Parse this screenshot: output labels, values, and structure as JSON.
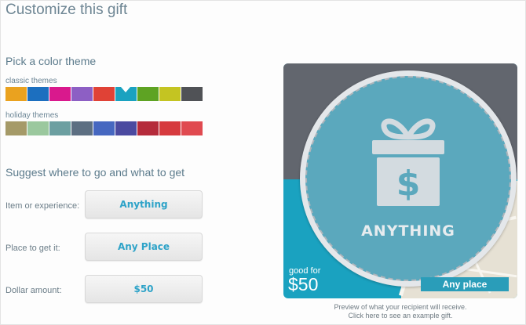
{
  "page": {
    "title": "Customize this gift"
  },
  "color_theme": {
    "heading": "Pick a color theme",
    "classic_label": "classic themes",
    "classic_swatches": [
      {
        "name": "swatch-orange",
        "color": "#eaa21f"
      },
      {
        "name": "swatch-blue",
        "color": "#1c6fbf"
      },
      {
        "name": "swatch-magenta",
        "color": "#d9198d"
      },
      {
        "name": "swatch-purple",
        "color": "#8d5fc4"
      },
      {
        "name": "swatch-red",
        "color": "#e04236"
      },
      {
        "name": "swatch-teal",
        "color": "#1aa2c0",
        "selected": true
      },
      {
        "name": "swatch-green",
        "color": "#5ea323"
      },
      {
        "name": "swatch-olive",
        "color": "#c4c422"
      },
      {
        "name": "swatch-charcoal",
        "color": "#505256"
      }
    ],
    "holiday_label": "holiday themes",
    "holiday_swatches": [
      {
        "name": "swatch-khaki",
        "color": "#a59a68"
      },
      {
        "name": "swatch-sage",
        "color": "#9bc89e"
      },
      {
        "name": "swatch-slate-teal",
        "color": "#6c9fa1"
      },
      {
        "name": "swatch-steel",
        "color": "#5d6f82"
      },
      {
        "name": "swatch-royal-blue",
        "color": "#4667c0"
      },
      {
        "name": "swatch-indigo",
        "color": "#4b4aa0"
      },
      {
        "name": "swatch-crimson",
        "color": "#b52b3b"
      },
      {
        "name": "swatch-red",
        "color": "#d63a3e"
      },
      {
        "name": "swatch-coral-red",
        "color": "#e04a50"
      }
    ]
  },
  "suggest": {
    "heading": "Suggest where to go and what to get",
    "item_label": "Item or experience:",
    "item_value": "Anything",
    "place_label": "Place to get it:",
    "place_value": "Any Place",
    "amount_label": "Dollar amount:",
    "amount_value": "$50"
  },
  "preview": {
    "badge_text": "ANYTHING",
    "good_for": "good for",
    "amount": "$50",
    "place": "Any place",
    "caption_line1": "Preview of what your recipient will receive.",
    "caption_line2": "Click here to see an example gift.",
    "colors": {
      "top": "#62666e",
      "bottom": "#1aa2c0",
      "badge": "#5ba8bd",
      "icon": "#d3dbe0"
    }
  }
}
